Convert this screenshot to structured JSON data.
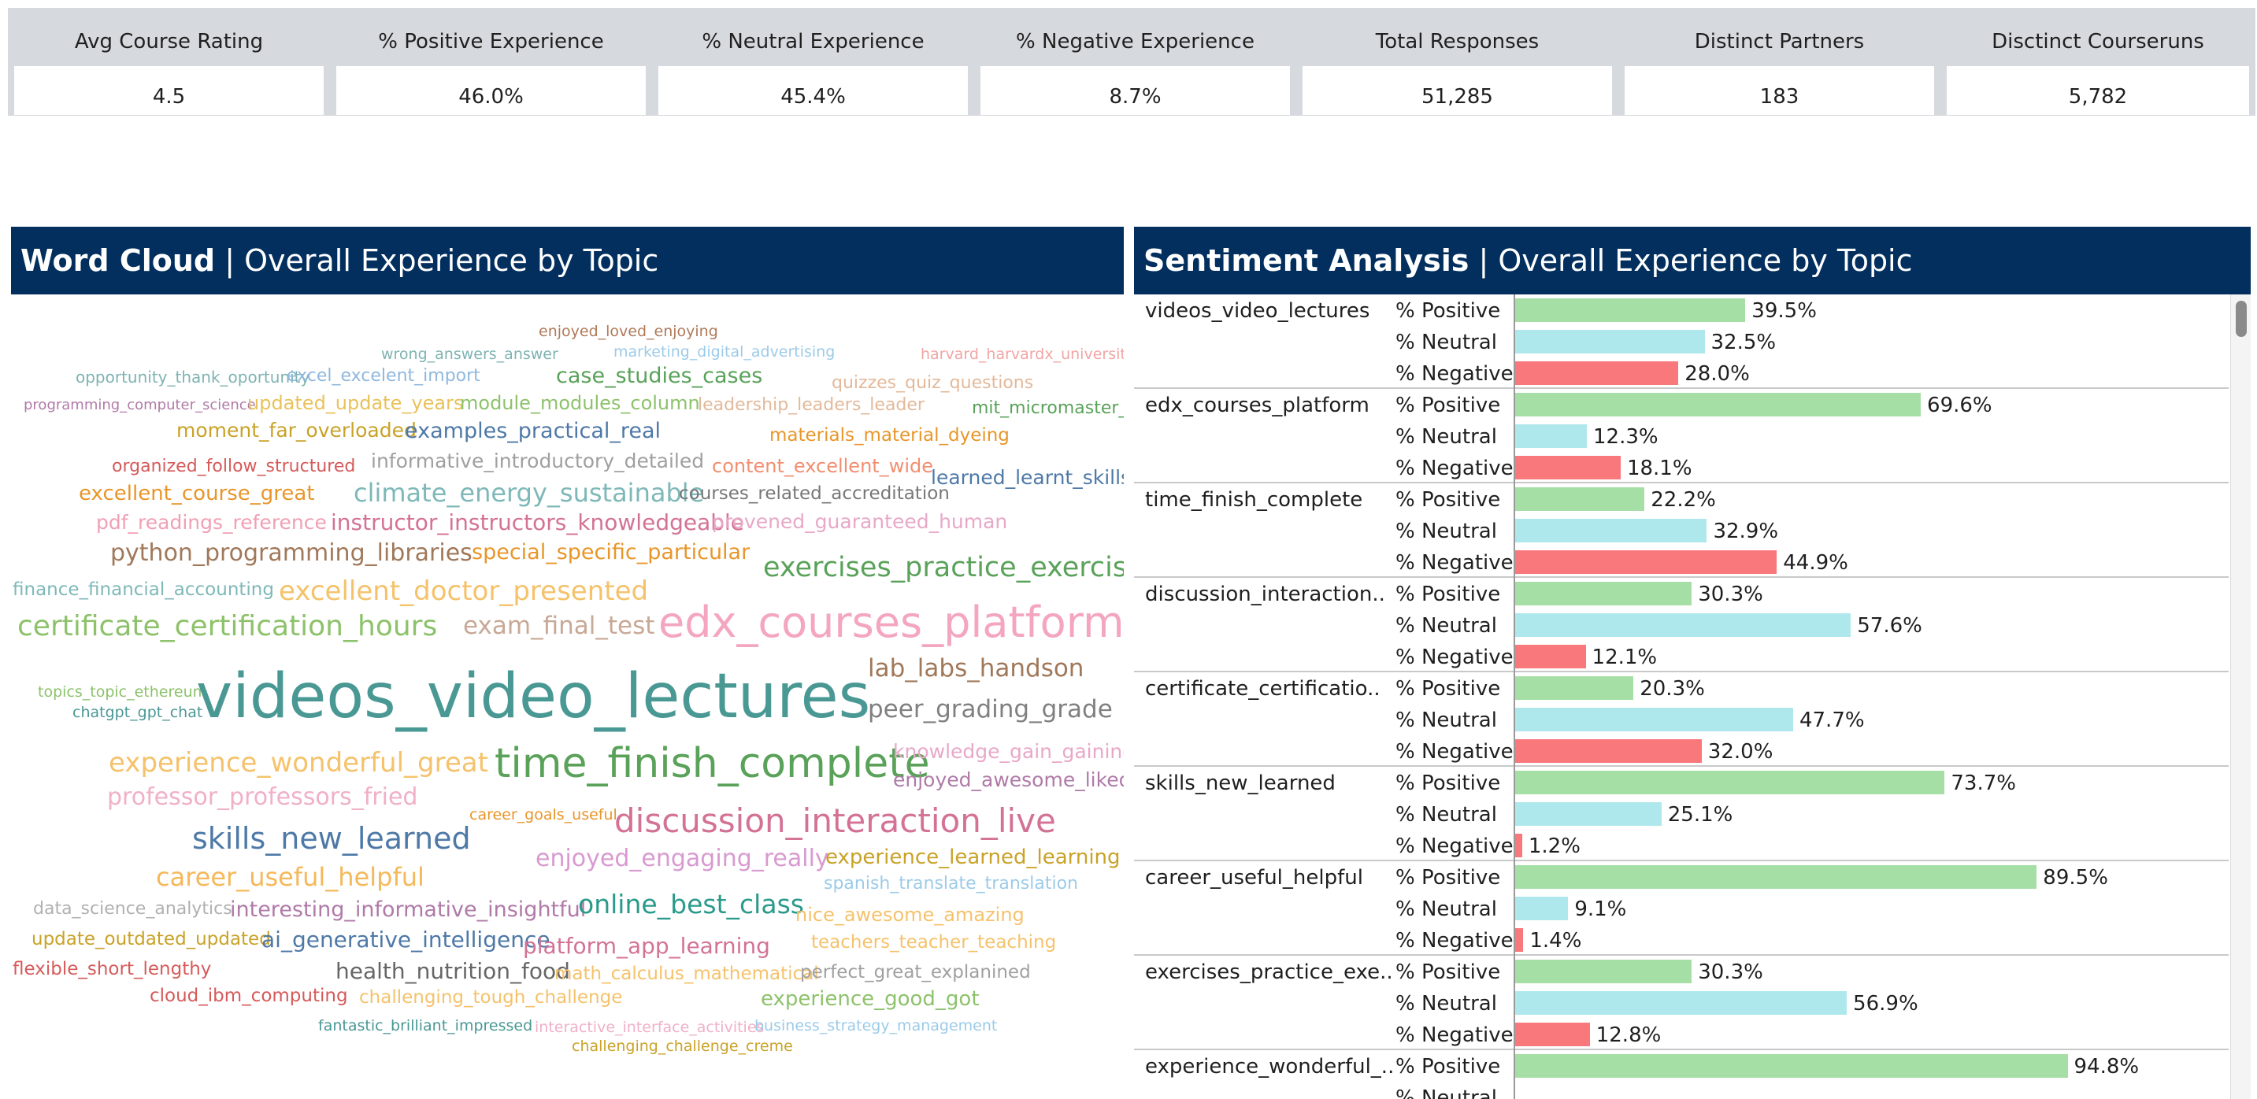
{
  "kpis": [
    {
      "label": "Avg Course Rating",
      "value": "4.5"
    },
    {
      "label": "% Positive Experience",
      "value": "46.0%"
    },
    {
      "label": "% Neutral Experience",
      "value": "45.4%"
    },
    {
      "label": "% Negative Experience",
      "value": "8.7%"
    },
    {
      "label": "Total Responses",
      "value": "51,285"
    },
    {
      "label": "Distinct Partners",
      "value": "183"
    },
    {
      "label": "Disctinct Courseruns",
      "value": "5,782"
    }
  ],
  "word_cloud": {
    "title_bold": "Word Cloud",
    "separator": "|",
    "title_rest": "Overall Experience by Topic",
    "words": [
      {
        "text": "enjoyed_loved_enjoying",
        "color": "#b07a5a"
      },
      {
        "text": "wrong_answers_answer",
        "color": "#7fb3b3"
      },
      {
        "text": "marketing_digital_advertising",
        "color": "#9ccbe8"
      },
      {
        "text": "harvard_harvardx_university",
        "color": "#f2a5a5"
      },
      {
        "text": "opportunity_thank_oportunity",
        "color": "#7fb3b3"
      },
      {
        "text": "excel_excelent_import",
        "color": "#8fb8dd"
      },
      {
        "text": "case_studies_cases",
        "color": "#5aa25a"
      },
      {
        "text": "quizzes_quiz_questions",
        "color": "#e3b99a"
      },
      {
        "text": "programming_computer_science",
        "color": "#b07aa8"
      },
      {
        "text": "updated_update_years",
        "color": "#e8c25a"
      },
      {
        "text": "module_modules_column",
        "color": "#8dc26b"
      },
      {
        "text": "leadership_leaders_leader",
        "color": "#e3b99a"
      },
      {
        "text": "mit_micromaster_mitx",
        "color": "#5aa25a"
      },
      {
        "text": "moment_far_overloaded",
        "color": "#c9a227"
      },
      {
        "text": "examples_practical_real",
        "color": "#4e79a7"
      },
      {
        "text": "materials_material_dyeing",
        "color": "#e8962a"
      },
      {
        "text": "organized_follow_structured",
        "color": "#d65a5a"
      },
      {
        "text": "informative_introductory_detailed",
        "color": "#a0a0a0"
      },
      {
        "text": "content_excellent_wide",
        "color": "#f28e70"
      },
      {
        "text": "learned_learnt_skills",
        "color": "#4e79a7"
      },
      {
        "text": "excellent_course_great",
        "color": "#e8962a"
      },
      {
        "text": "climate_energy_sustainable",
        "color": "#7fb8b8"
      },
      {
        "text": "courses_related_accreditation",
        "color": "#777777"
      },
      {
        "text": "pdf_readings_reference",
        "color": "#f0a0b4"
      },
      {
        "text": "instructor_instructors_knowledgeable",
        "color": "#d37295"
      },
      {
        "text": "provened_guaranteed_human",
        "color": "#e8a8c8"
      },
      {
        "text": "python_programming_libraries",
        "color": "#a0785a"
      },
      {
        "text": "special_specific_particular",
        "color": "#e8962a"
      },
      {
        "text": "exercises_practice_exercise",
        "color": "#5aa25a"
      },
      {
        "text": "finance_financial_accounting",
        "color": "#7fb8b8"
      },
      {
        "text": "excellent_doctor_presented",
        "color": "#f5c26b"
      },
      {
        "text": "certificate_certification_hours",
        "color": "#8dc26b"
      },
      {
        "text": "exam_final_test",
        "color": "#c8a896"
      },
      {
        "text": "edx_courses_platform",
        "color": "#f4a6c0"
      },
      {
        "text": "topics_topic_ethereum",
        "color": "#8dc26b"
      },
      {
        "text": "lab_labs_handson",
        "color": "#a0785a"
      },
      {
        "text": "chatgpt_gpt_chat",
        "color": "#499894"
      },
      {
        "text": "videos_video_lectures",
        "color": "#499894"
      },
      {
        "text": "peer_grading_grade",
        "color": "#808080"
      },
      {
        "text": "experience_wonderful_great",
        "color": "#f5c26b"
      },
      {
        "text": "time_finish_complete",
        "color": "#5aa25a"
      },
      {
        "text": "knowledge_gain_gaining",
        "color": "#e8a8c8"
      },
      {
        "text": "enjoyed_awesome_liked",
        "color": "#b07aa8"
      },
      {
        "text": "professor_professors_fried",
        "color": "#f0b0c8"
      },
      {
        "text": "career_goals_useful",
        "color": "#e8962a"
      },
      {
        "text": "discussion_interaction_live",
        "color": "#d37295"
      },
      {
        "text": "skills_new_learned",
        "color": "#4e79a7"
      },
      {
        "text": "enjoyed_engaging_really",
        "color": "#d89ad0"
      },
      {
        "text": "experience_learned_learning",
        "color": "#c9a227"
      },
      {
        "text": "career_useful_helpful",
        "color": "#f5b85a"
      },
      {
        "text": "spanish_translate_translation",
        "color": "#9ccbe8"
      },
      {
        "text": "data_science_analytics",
        "color": "#b0b0b0"
      },
      {
        "text": "interesting_informative_insightful",
        "color": "#b07aa8"
      },
      {
        "text": "online_best_class",
        "color": "#2a9a8a"
      },
      {
        "text": "nice_awesome_amazing",
        "color": "#f5c26b"
      },
      {
        "text": "update_outdated_updated",
        "color": "#c9a227"
      },
      {
        "text": "ai_generative_intelligence",
        "color": "#4e79a7"
      },
      {
        "text": "platform_app_learning",
        "color": "#d37295"
      },
      {
        "text": "teachers_teacher_teaching",
        "color": "#f5c26b"
      },
      {
        "text": "flexible_short_lengthy",
        "color": "#d65a5a"
      },
      {
        "text": "health_nutrition_food",
        "color": "#666666"
      },
      {
        "text": "math_calculus_mathematical",
        "color": "#f5c26b"
      },
      {
        "text": "perfect_great_explanined",
        "color": "#a0a0a0"
      },
      {
        "text": "cloud_ibm_computing",
        "color": "#d65a5a"
      },
      {
        "text": "challenging_tough_challenge",
        "color": "#f5c26b"
      },
      {
        "text": "experience_good_got",
        "color": "#8dc26b"
      },
      {
        "text": "fantastic_brilliant_impressed",
        "color": "#499894"
      },
      {
        "text": "interactive_interface_activities",
        "color": "#f0b0c8"
      },
      {
        "text": "business_strategy_management",
        "color": "#9ccbe8"
      },
      {
        "text": "challenging_challenge_creme",
        "color": "#c9a227"
      }
    ]
  },
  "chart_data": {
    "type": "bar",
    "orientation": "horizontal",
    "title": "Sentiment Analysis | Overall Experience by Topic",
    "title_bold": "Sentiment Analysis",
    "separator": "|",
    "title_rest": "Overall Experience by Topic",
    "measures": [
      "% Positive",
      "% Neutral",
      "% Negative"
    ],
    "measure_colors": [
      "#a6dfa6",
      "#aee8ec",
      "#f8787c"
    ],
    "xlim": [
      0,
      100
    ],
    "grid": false,
    "categories": [
      "videos_video_lectures",
      "edx_courses_platform",
      "time_finish_complete",
      "discussion_interaction..",
      "certificate_certificatio..",
      "skills_new_learned",
      "career_useful_helpful",
      "exercises_practice_exe..",
      "experience_wonderful_.."
    ],
    "series": [
      {
        "name": "% Positive",
        "values": [
          39.5,
          69.6,
          22.2,
          30.3,
          20.3,
          73.7,
          89.5,
          30.3,
          94.8
        ],
        "labels": [
          "39.5%",
          "69.6%",
          "22.2%",
          "30.3%",
          "20.3%",
          "73.7%",
          "89.5%",
          "30.3%",
          "94.8%"
        ]
      },
      {
        "name": "% Neutral",
        "values": [
          32.5,
          12.3,
          32.9,
          57.6,
          47.7,
          25.1,
          9.1,
          56.9,
          null
        ],
        "labels": [
          "32.5%",
          "12.3%",
          "32.9%",
          "57.6%",
          "47.7%",
          "25.1%",
          "9.1%",
          "56.9%",
          ""
        ]
      },
      {
        "name": "% Negative",
        "values": [
          28.0,
          18.1,
          44.9,
          12.1,
          32.0,
          1.2,
          1.4,
          12.8,
          null
        ],
        "labels": [
          "28.0%",
          "18.1%",
          "44.9%",
          "12.1%",
          "32.0%",
          "1.2%",
          "1.4%",
          "12.8%",
          ""
        ]
      }
    ]
  }
}
